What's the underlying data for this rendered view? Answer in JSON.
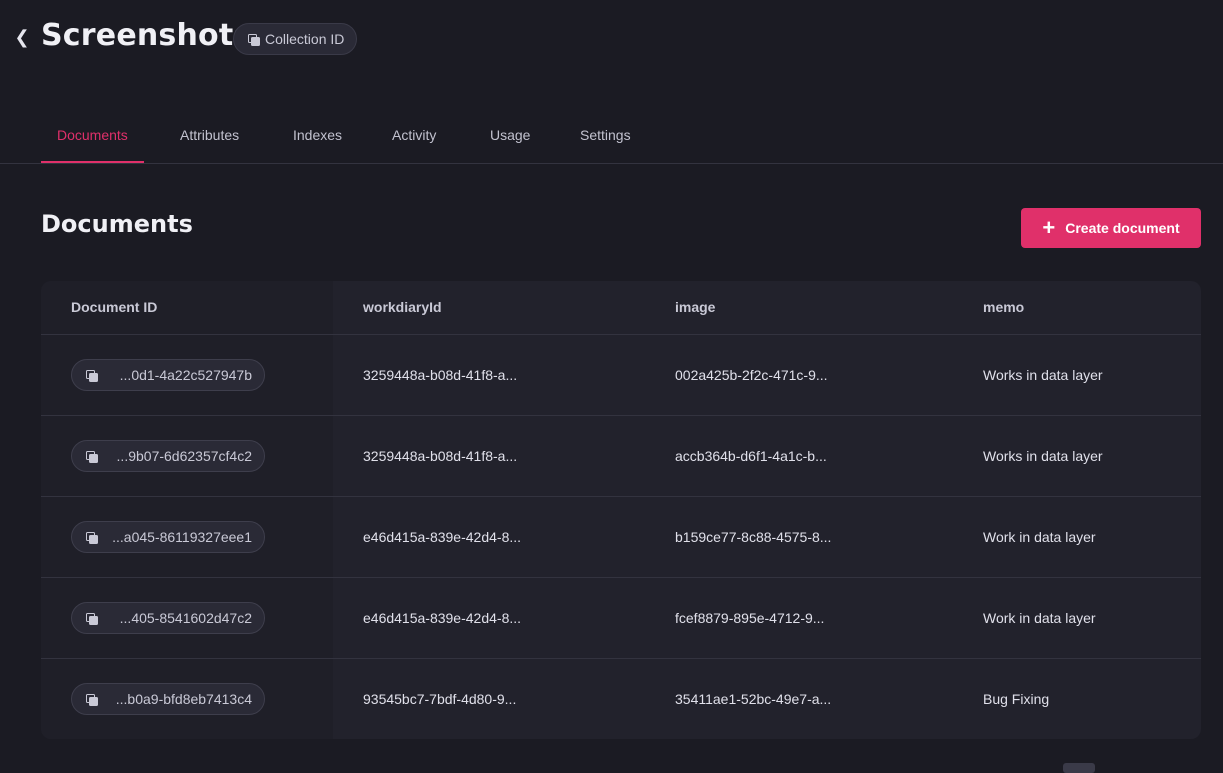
{
  "header": {
    "title": "Screenshots",
    "collection_id_label": "Collection ID"
  },
  "tabs": [
    {
      "label": "Documents",
      "active": true
    },
    {
      "label": "Attributes",
      "active": false
    },
    {
      "label": "Indexes",
      "active": false
    },
    {
      "label": "Activity",
      "active": false
    },
    {
      "label": "Usage",
      "active": false
    },
    {
      "label": "Settings",
      "active": false
    }
  ],
  "section": {
    "title": "Documents",
    "create_label": "Create document"
  },
  "table": {
    "columns": [
      "Document ID",
      "workdiaryId",
      "image",
      "memo"
    ],
    "rows": [
      {
        "id": "...0d1-4a22c527947b",
        "workdiaryId": "3259448a-b08d-41f8-a...",
        "image": "002a425b-2f2c-471c-9...",
        "memo": "Works in data layer"
      },
      {
        "id": "...9b07-6d62357cf4c2",
        "workdiaryId": "3259448a-b08d-41f8-a...",
        "image": "accb364b-d6f1-4a1c-b...",
        "memo": "Works in data layer"
      },
      {
        "id": "...a045-86119327eee1",
        "workdiaryId": "e46d415a-839e-42d4-8...",
        "image": "b159ce77-8c88-4575-8...",
        "memo": "Work in data layer"
      },
      {
        "id": "...405-8541602d47c2",
        "workdiaryId": "e46d415a-839e-42d4-8...",
        "image": "fcef8879-895e-4712-9...",
        "memo": "Work in data layer"
      },
      {
        "id": "...b0a9-bfd8eb7413c4",
        "workdiaryId": "93545bc7-7bdf-4d80-9...",
        "image": "35411ae1-52bc-49e7-a...",
        "memo": "Bug Fixing"
      }
    ]
  },
  "colors": {
    "accent": "#e0306a",
    "background": "#1b1b23",
    "surface": "#22222c"
  },
  "icons": {
    "back": "chevron-left-icon",
    "copy": "copy-icon",
    "plus": "plus-icon"
  }
}
